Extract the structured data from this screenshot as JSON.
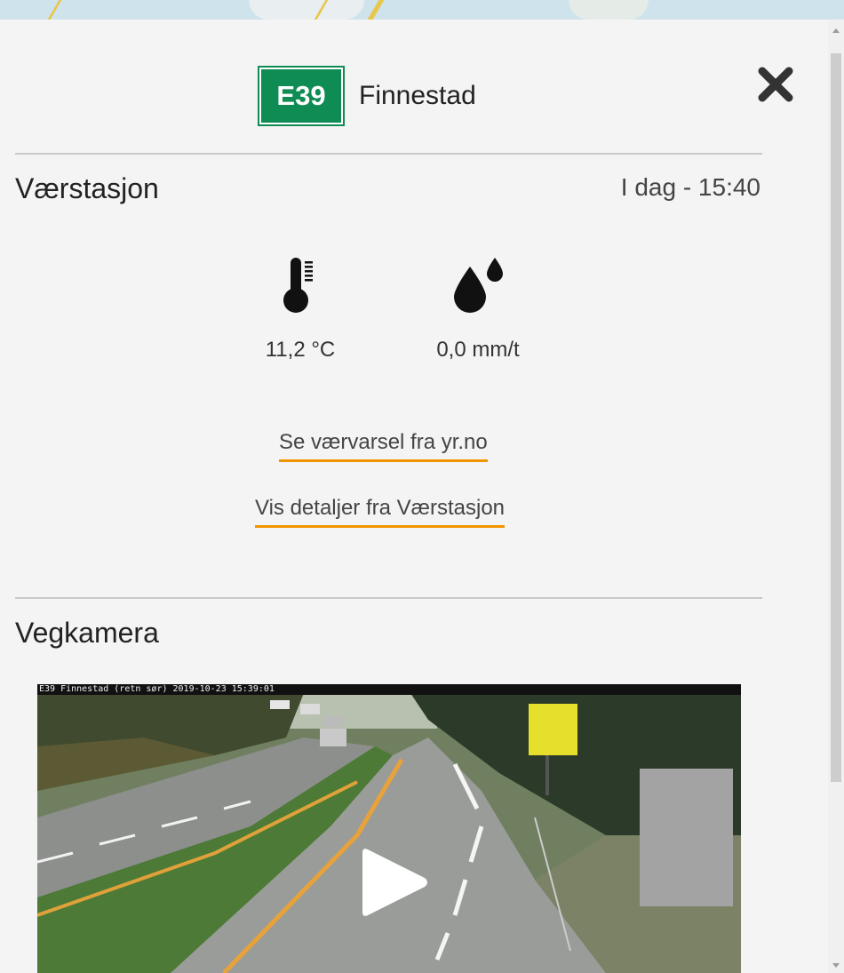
{
  "header": {
    "road_number": "E39",
    "place": "Finnestad"
  },
  "weather_station": {
    "title": "Værstasjon",
    "timestamp": "I dag - 15:40",
    "temperature": "11,2 °C",
    "precipitation": "0,0 mm/t",
    "icons": [
      "thermometer-icon",
      "raindrops-icon"
    ],
    "links": {
      "forecast": "Se værvarsel fra yr.no",
      "details": "Vis detaljer fra Værstasjon"
    }
  },
  "road_camera": {
    "title": "Vegkamera",
    "overlay_text": "E39 Finnestad (retn sør) 2019-10-23 15:39:01"
  },
  "colors": {
    "road_badge": "#0f8b54",
    "link_underline": "#f29400"
  }
}
